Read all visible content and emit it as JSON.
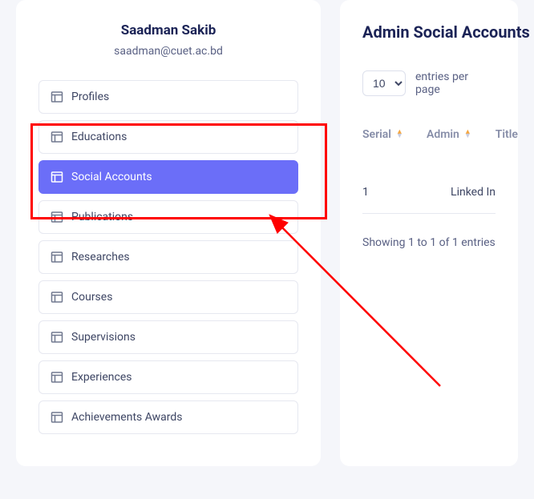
{
  "profile": {
    "name": "Saadman Sakib",
    "email": "saadman@cuet.ac.bd"
  },
  "nav": {
    "items": [
      {
        "label": "Profiles",
        "active": false
      },
      {
        "label": "Educations",
        "active": false
      },
      {
        "label": "Social Accounts",
        "active": true
      },
      {
        "label": "Publications",
        "active": false
      },
      {
        "label": "Researches",
        "active": false
      },
      {
        "label": "Courses",
        "active": false
      },
      {
        "label": "Supervisions",
        "active": false
      },
      {
        "label": "Experiences",
        "active": false
      },
      {
        "label": "Achievements Awards",
        "active": false
      }
    ]
  },
  "main": {
    "title": "Admin Social Accounts",
    "entries_per_page": "10",
    "entries_label": "entries per page",
    "columns": {
      "serial": "Serial",
      "admin": "Admin",
      "title": "Title"
    },
    "rows": [
      {
        "serial": "1",
        "admin": "",
        "title": "Linked In"
      }
    ],
    "showing": "Showing 1 to 1 of 1 entries"
  }
}
